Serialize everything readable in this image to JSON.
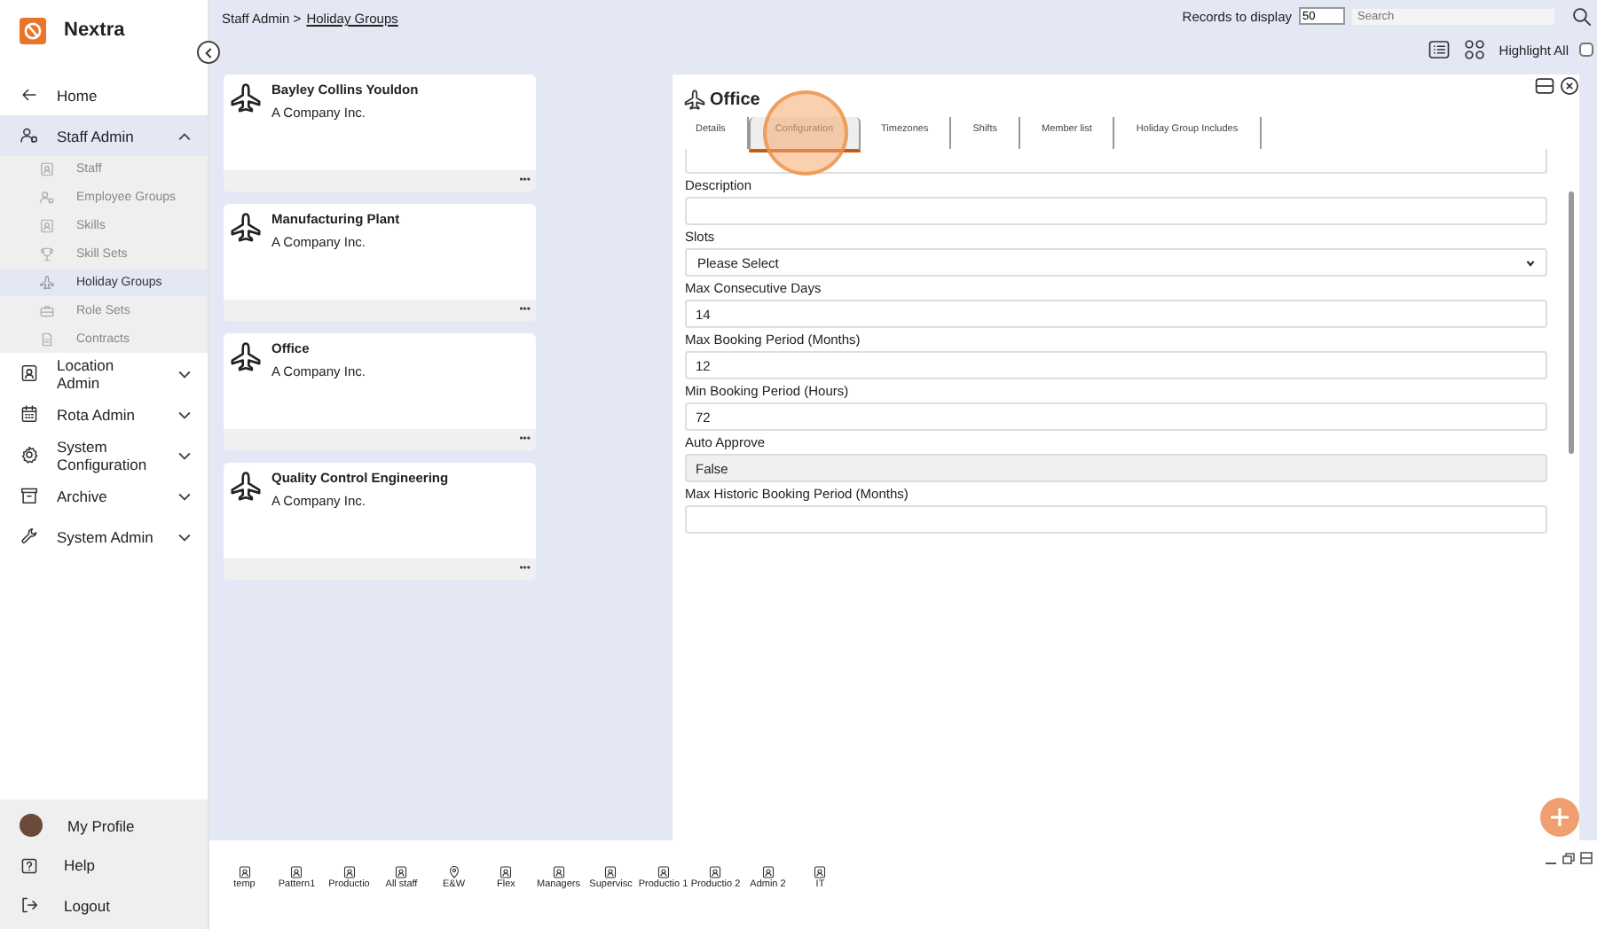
{
  "app": {
    "name": "Nextra"
  },
  "nav": [
    {
      "label": "Home",
      "kind": "link"
    },
    {
      "label": "Staff Admin",
      "kind": "group",
      "expanded": true,
      "children": [
        {
          "label": "Staff",
          "selected": false
        },
        {
          "label": "Employee Groups",
          "selected": false
        },
        {
          "label": "Skills",
          "selected": false
        },
        {
          "label": "Skill Sets",
          "selected": false
        },
        {
          "label": "Holiday Groups",
          "selected": true
        },
        {
          "label": "Role Sets",
          "selected": false
        },
        {
          "label": "Contracts",
          "selected": false
        }
      ]
    },
    {
      "label": "Location Admin",
      "kind": "group",
      "expanded": false
    },
    {
      "label": "Rota Admin",
      "kind": "group",
      "expanded": false
    },
    {
      "label": "System Configuration",
      "kind": "group",
      "expanded": false
    },
    {
      "label": "Archive",
      "kind": "group",
      "expanded": false
    },
    {
      "label": "System Admin",
      "kind": "group",
      "expanded": false
    }
  ],
  "user_menu": [
    {
      "label": "My Profile"
    },
    {
      "label": "Help"
    },
    {
      "label": "Logout"
    }
  ],
  "breadcrumb": {
    "parent": "Staff Admin >",
    "current": "Holiday Groups"
  },
  "records": {
    "label": "Records to display",
    "value": "50"
  },
  "search": {
    "placeholder": "Search"
  },
  "highlight_all": {
    "label": "Highlight All",
    "checked": false
  },
  "cards": [
    {
      "title": "Bayley Collins Youldon",
      "subtitle": "A Company Inc.",
      "more": "•••"
    },
    {
      "title": "Manufacturing Plant",
      "subtitle": "A Company Inc.",
      "more": "•••"
    },
    {
      "title": "Office",
      "subtitle": "A Company Inc.",
      "more": "•••"
    },
    {
      "title": "Quality Control Engineering",
      "subtitle": "A Company Inc.",
      "more": "•••"
    }
  ],
  "detail": {
    "title": "Office",
    "tabs": [
      {
        "label": "Details",
        "selected": false
      },
      {
        "label": "Configuration",
        "selected": true
      },
      {
        "label": "Timezones",
        "selected": false
      },
      {
        "label": "Shifts",
        "selected": false
      },
      {
        "label": "Member list",
        "selected": false
      },
      {
        "label": "Holiday Group Includes",
        "selected": false
      }
    ],
    "fields": [
      {
        "kind": "partial",
        "disabled": false
      },
      {
        "kind": "text",
        "label": "Description",
        "disabled": false
      },
      {
        "kind": "select",
        "label": "Slots",
        "value": "Please Select",
        "disabled": false
      },
      {
        "kind": "text",
        "label": "Max Consecutive Days",
        "value": "14",
        "disabled": false
      },
      {
        "kind": "text",
        "label": "Max Booking Period (Months)",
        "value": "12",
        "disabled": false
      },
      {
        "kind": "text",
        "label": "Min Booking Period (Hours)",
        "value": "72",
        "disabled": false
      },
      {
        "kind": "text",
        "label": "Auto Approve",
        "value": "False",
        "disabled": true
      },
      {
        "kind": "text",
        "label": "Max Historic Booking Period (Months)",
        "disabled": false
      }
    ]
  },
  "taskbar": [
    {
      "label": "temp"
    },
    {
      "label": "Pattern1"
    },
    {
      "label": "Productio"
    },
    {
      "label": "All staff"
    },
    {
      "label": "E&W"
    },
    {
      "label": "Flex"
    },
    {
      "label": "Managers"
    },
    {
      "label": "Supervisc"
    },
    {
      "label": "Productio 1"
    },
    {
      "label": "Productio 2"
    },
    {
      "label": "Admin 2"
    },
    {
      "label": "IT"
    }
  ]
}
